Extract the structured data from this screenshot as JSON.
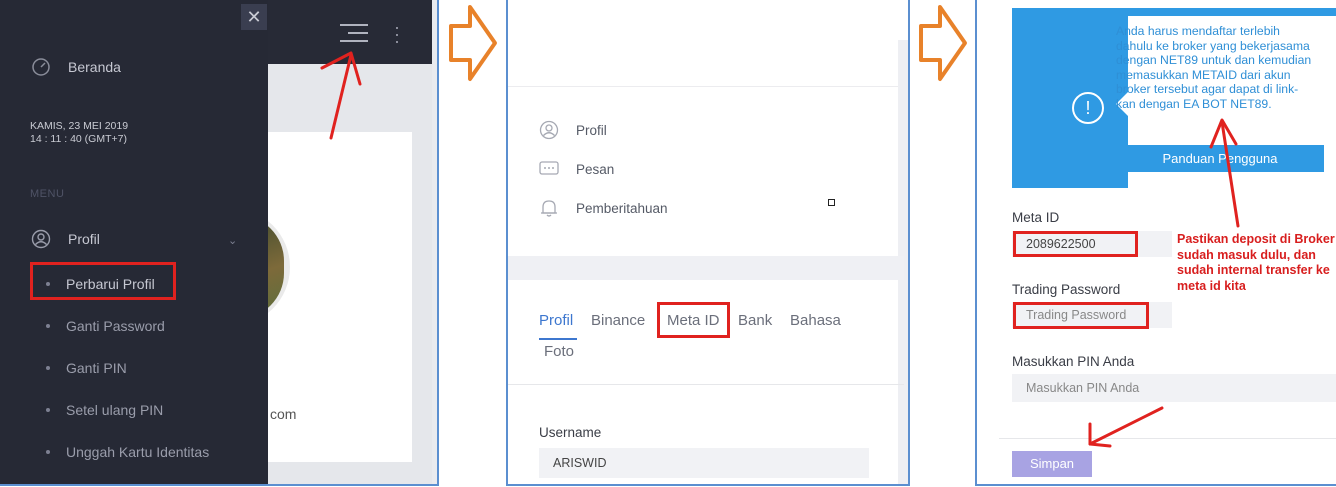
{
  "panel1": {
    "sidebar": {
      "close_glyph": "✕",
      "home_label": "Beranda",
      "date": "KAMIS, 23 MEI 2019",
      "time": "14 : 11 : 40 (GMT+7)",
      "menu_header": "MENU",
      "profile_label": "Profil",
      "subitems": [
        "Perbarui Profil",
        "Ganti Password",
        "Ganti PIN",
        "Setel ulang PIN",
        "Unggah Kartu Identitas"
      ]
    },
    "email_fragment": "com"
  },
  "panel2": {
    "menu_items": [
      "Profil",
      "Pesan",
      "Pemberitahuan"
    ],
    "tabs": [
      "Profil",
      "Binance",
      "Meta ID",
      "Bank",
      "Bahasa",
      "Foto"
    ],
    "username_label": "Username",
    "username_value": "ARISWID"
  },
  "panel3": {
    "alert_text": "Anda harus mendaftar terlebih dahulu ke broker yang bekerjasama dengan NET89 untuk dan kemudian memasukkan METAID dari akun broker tersebut agar dapat di link-kan dengan EA BOT NET89.",
    "guide_button": "Panduan Pengguna",
    "meta_id_label": "Meta ID",
    "meta_id_value": "2089622500",
    "trading_password_label": "Trading Password",
    "trading_password_placeholder": "Trading Password",
    "pin_label": "Masukkan PIN Anda",
    "pin_placeholder": "Masukkan PIN Anda",
    "note": "Pastikan deposit di Broker sudah masuk dulu, dan sudah internal transfer ke meta id kita",
    "save_button": "Simpan"
  },
  "colors": {
    "sidebar_bg": "#262935",
    "highlight_red": "#e0221f",
    "primary_blue": "#2f9ae3",
    "flow_arrow_orange": "#e8822a",
    "save_purple": "#a8a3e3"
  }
}
